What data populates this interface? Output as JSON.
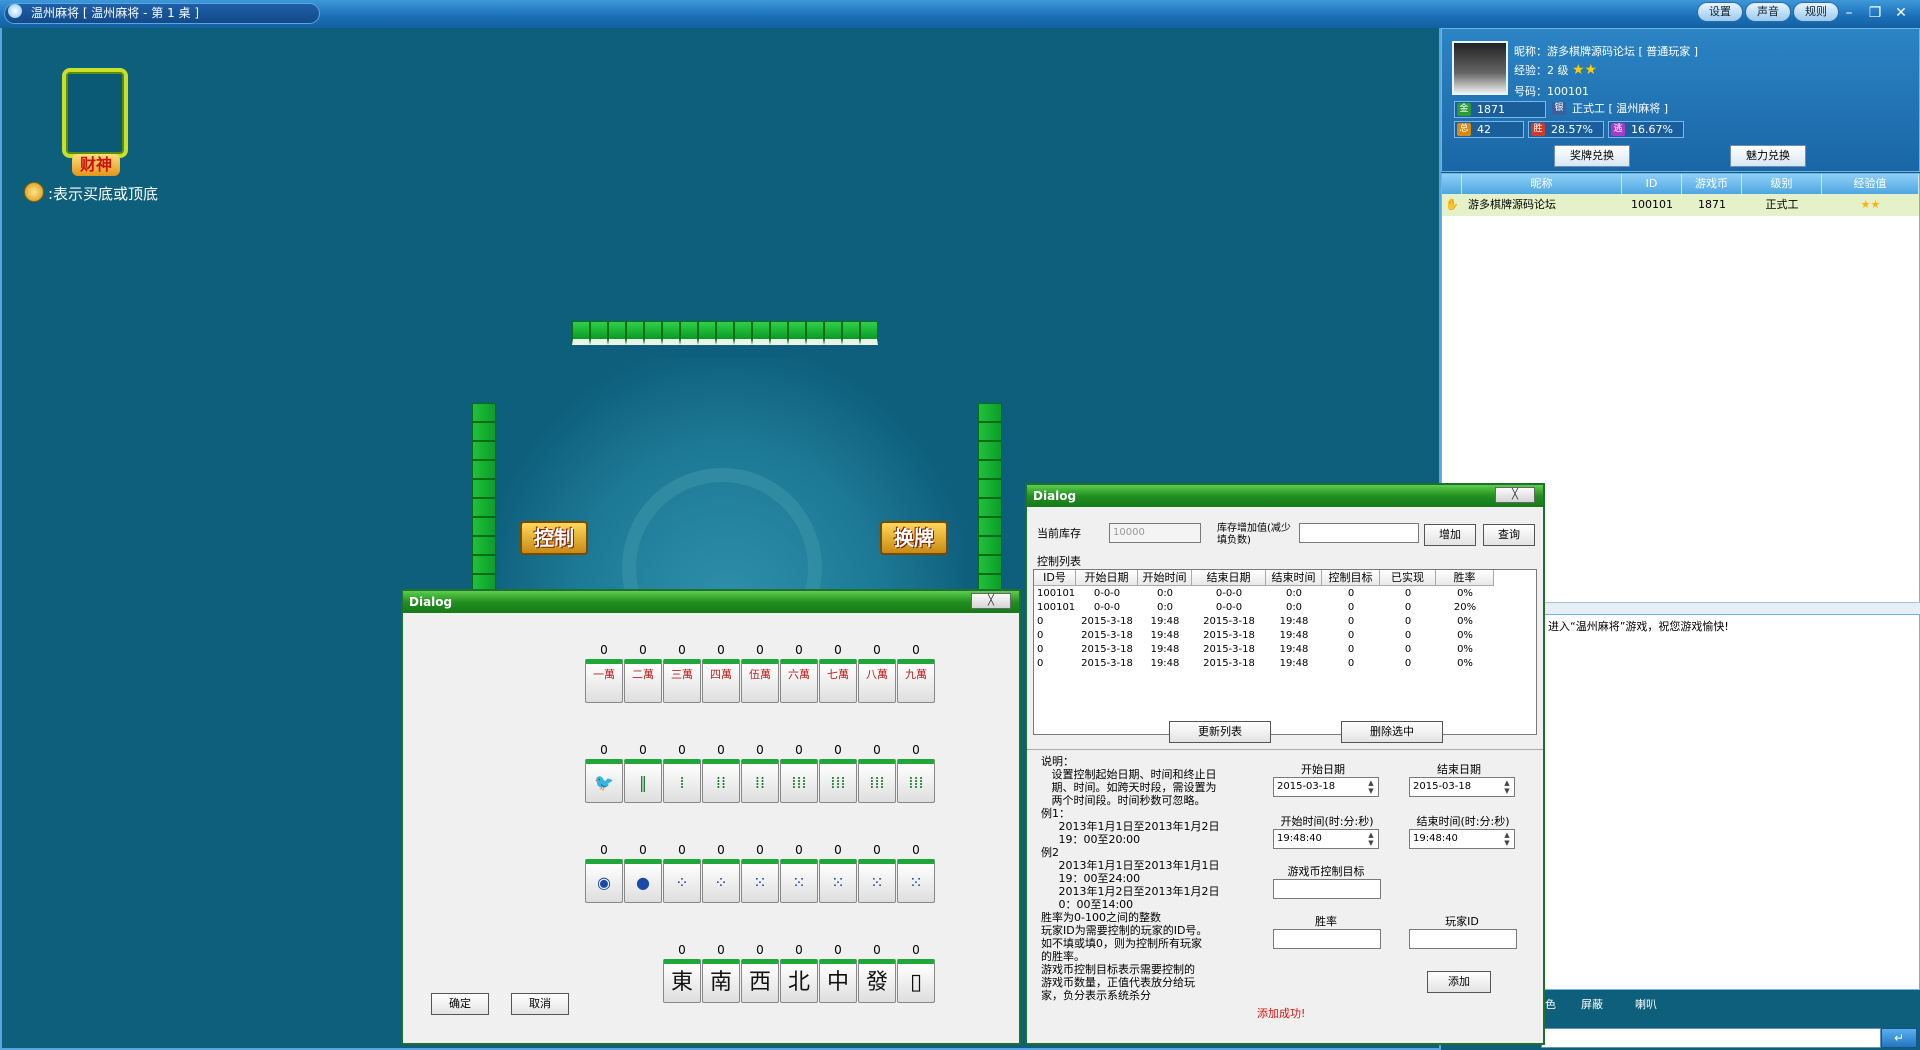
{
  "window": {
    "title": "温州麻将 [ 温州麻将 - 第 1 桌 ]",
    "buttons": [
      "设置",
      "声音",
      "规则"
    ],
    "controls": [
      "–",
      "❐",
      "✕"
    ]
  },
  "game": {
    "caishen_label": "财神",
    "hint": ":表示买底或顶底",
    "control_button": "控制",
    "swap_button": "换牌"
  },
  "user": {
    "nickname_line": "昵称：游多棋牌源码论坛 [ 普通玩家 ]",
    "exp_line": "经验：2 级",
    "stars": "★★",
    "id_line": "号码：100101",
    "gold": "1871",
    "silver_label": "正式工 [ 温州麻将 ]",
    "total": "42",
    "win_rate": "28.57%",
    "escape_rate": "16.67%",
    "icons": {
      "gold": "金",
      "silver": "银",
      "total": "总",
      "win": "胜",
      "escape": "逃"
    },
    "reward_button": "奖牌兑换",
    "charm_button": "魅力兑换"
  },
  "player_list": {
    "headers": [
      "昵称",
      "ID",
      "游戏币",
      "级别",
      "经验值"
    ],
    "rows": [
      {
        "nickname": "游多棋牌源码论坛",
        "id": "100101",
        "coins": "1871",
        "level": "正式工",
        "exp": "★★"
      }
    ]
  },
  "chat": {
    "message": "进入“温州麻将”游戏，祝您游戏愉快!",
    "toolbar": [
      "色",
      "屏蔽",
      "喇叭"
    ],
    "send": "↵"
  },
  "tile_dialog": {
    "title": "Dialog",
    "close": "╳",
    "rows": [
      {
        "counts": [
          "0",
          "0",
          "0",
          "0",
          "0",
          "0",
          "0",
          "0",
          "0"
        ],
        "faces": [
          "一萬",
          "二萬",
          "三萬",
          "四萬",
          "伍萬",
          "六萬",
          "七萬",
          "八萬",
          "九萬"
        ],
        "color": "#b22"
      },
      {
        "counts": [
          "0",
          "0",
          "0",
          "0",
          "0",
          "0",
          "0",
          "0",
          "0"
        ],
        "faces": [
          "🐦",
          "‖",
          "⁞",
          "⁞⁞",
          "⁞⁞",
          "⁞⁞⁞",
          "⁞⁞⁞",
          "⁞⁞⁞",
          "⁞⁞⁞"
        ],
        "color": "#197a2c"
      },
      {
        "counts": [
          "0",
          "0",
          "0",
          "0",
          "0",
          "0",
          "0",
          "0",
          "0"
        ],
        "faces": [
          "◉",
          "●",
          "⁘",
          "⁘",
          "⁙",
          "⁙",
          "⁙",
          "⁙",
          "⁙"
        ],
        "color": "#1a4aa8"
      },
      {
        "counts": [
          "0",
          "0",
          "0",
          "0",
          "0",
          "0",
          "0"
        ],
        "faces": [
          "東",
          "南",
          "西",
          "北",
          "中",
          "發",
          "▯"
        ],
        "color": "#111"
      }
    ],
    "ok": "确定",
    "cancel": "取消"
  },
  "control_dialog": {
    "title": "Dialog",
    "close": "╳",
    "stock_label": "当前库存",
    "stock_value": "10000",
    "inc_label": "库存增加值(减少填负数)",
    "inc_value": "",
    "add_button": "增加",
    "query_button": "查询",
    "list_label": "控制列表",
    "columns": [
      "ID号",
      "开始日期",
      "开始时间",
      "结束日期",
      "结束时间",
      "控制目标",
      "已实现",
      "胜率"
    ],
    "rows": [
      [
        "100101",
        "0-0-0",
        "0:0",
        "0-0-0",
        "0:0",
        "0",
        "0",
        "0%"
      ],
      [
        "100101",
        "0-0-0",
        "0:0",
        "0-0-0",
        "0:0",
        "0",
        "0",
        "20%"
      ],
      [
        "0",
        "2015-3-18",
        "19:48",
        "2015-3-18",
        "19:48",
        "0",
        "0",
        "0%"
      ],
      [
        "0",
        "2015-3-18",
        "19:48",
        "2015-3-18",
        "19:48",
        "0",
        "0",
        "0%"
      ],
      [
        "0",
        "2015-3-18",
        "19:48",
        "2015-3-18",
        "19:48",
        "0",
        "0",
        "0%"
      ],
      [
        "0",
        "2015-3-18",
        "19:48",
        "2015-3-18",
        "19:48",
        "0",
        "0",
        "0%"
      ]
    ],
    "refresh_button": "更新列表",
    "delete_button": "删除选中",
    "notes": "说明：\n   设置控制起始日期、时间和终止日\n   期、时间。如跨天时段，需设置为\n   两个时间段。时间秒数可忽略。\n例1：\n     2013年1月1日至2013年1月2日\n     19：00至20:00\n例2\n     2013年1月1日至2013年1月1日\n     19：00至24:00\n     2013年1月2日至2013年1月2日\n     0：00至14:00\n胜率为0-100之间的整数\n玩家ID为需要控制的玩家的ID号。\n如不填或填0，则为控制所有玩家\n的胜率。\n游戏币控制目标表示需要控制的\n游戏币数量，正值代表放分给玩\n家，负分表示系统杀分",
    "start_date_label": "开始日期",
    "start_date": "2015-03-18",
    "end_date_label": "结束日期",
    "end_date": "2015-03-18",
    "start_time_label": "开始时间(时:分:秒)",
    "start_time": "19:48:40",
    "end_time_label": "结束时间(时:分:秒)",
    "end_time": "19:48:40",
    "coin_target_label": "游戏币控制目标",
    "coin_target": "",
    "winrate_label": "胜率",
    "winrate": "",
    "player_id_label": "玩家ID",
    "player_id": "",
    "add2_button": "添加",
    "status": "添加成功!"
  }
}
